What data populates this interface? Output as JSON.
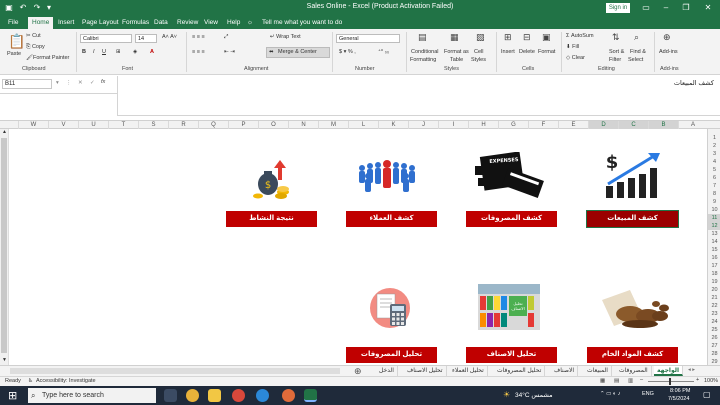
{
  "titlebar": {
    "title": "Sales Online  -  Excel (Product Activation Failed)",
    "signin": "Sign in"
  },
  "tabs": [
    "File",
    "Home",
    "Insert",
    "Page Layout",
    "Formulas",
    "Data",
    "Review",
    "View",
    "Help"
  ],
  "tellme": "Tell me what you want to do",
  "ribbon": {
    "paste": "Paste",
    "cut": "Cut",
    "copy": "Copy",
    "format_painter": "Format Painter",
    "font_name": "Calibri",
    "font_size": "14",
    "wrap_text": "Wrap Text",
    "merge_center": "Merge & Center",
    "number_format": "General",
    "conditional": "Conditional",
    "formatting": "Formatting",
    "format_as": "Format as",
    "table": "Table",
    "cell": "Cell",
    "styles": "Styles",
    "insert": "Insert",
    "delete": "Delete",
    "format": "Format",
    "autosum": "AutoSum",
    "fill": "Fill",
    "clear": "Clear",
    "sort_filter": "Sort &",
    "filter": "Filter",
    "find_select": "Find &",
    "select": "Select",
    "addins": "Add-ins",
    "groups": {
      "clipboard": "Clipboard",
      "font": "Font",
      "alignment": "Alignment",
      "number": "Number",
      "styles": "Styles",
      "cells": "Cells",
      "editing": "Editing",
      "addins": "Add-ins"
    }
  },
  "formula_bar": {
    "name_box": "B11",
    "content": "كشف المبيعات"
  },
  "columns": [
    "W",
    "V",
    "U",
    "T",
    "S",
    "R",
    "Q",
    "P",
    "O",
    "N",
    "M",
    "L",
    "K",
    "J",
    "I",
    "H",
    "G",
    "F",
    "E",
    "D",
    "C",
    "B",
    "A"
  ],
  "rows": [
    "1",
    "2",
    "3",
    "4",
    "5",
    "6",
    "7",
    "8",
    "9",
    "10",
    "11",
    "12",
    "13",
    "14",
    "15",
    "16",
    "17",
    "18",
    "19",
    "20",
    "21",
    "22",
    "23",
    "24",
    "25",
    "26",
    "27",
    "28",
    "29"
  ],
  "dashboard": {
    "buttons": [
      {
        "label": "نتيجة النشاط"
      },
      {
        "label": "كشف العملاء"
      },
      {
        "label": "كشف المصروفات"
      },
      {
        "label": "كشف المبيعات"
      },
      {
        "label": "تحليل المصروفات"
      },
      {
        "label": "تحليل الاصناف"
      },
      {
        "label": "كشف المواد الخام"
      }
    ],
    "expenses_icon_text": "EXPENSES"
  },
  "sheet_tabs": [
    "الواجهة",
    "المصروفات",
    "المبيعات",
    "الاصناف",
    "تحليل المصروفات",
    "تحليل العملاء",
    "تحليل الاصناف",
    "الدخل"
  ],
  "statusbar": {
    "ready": "Ready",
    "accessibility": "Accessibility: Investigate",
    "zoom": "100%"
  },
  "taskbar": {
    "search_placeholder": "Type here to search",
    "weather": "34°C  مشمس",
    "time": "8:06 PM",
    "date": "7/5/2024",
    "language": "ENG"
  },
  "colors": {
    "excel_green": "#217346",
    "button_red": "#c00000"
  }
}
